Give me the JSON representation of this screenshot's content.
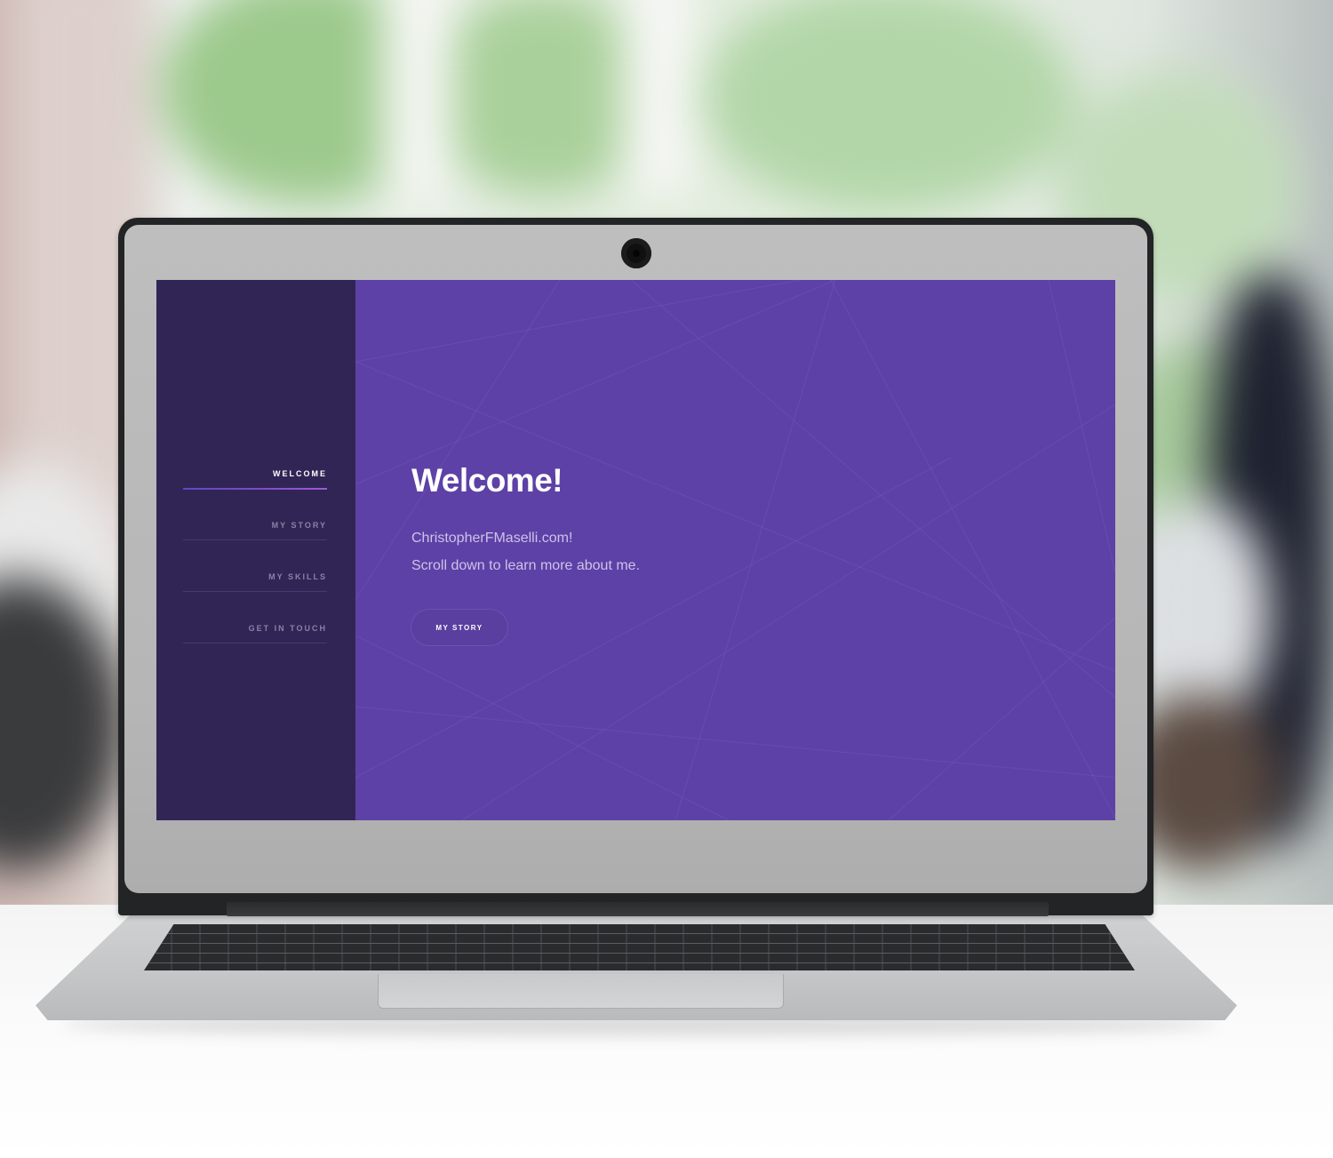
{
  "site": {
    "nav": [
      {
        "label": "WELCOME",
        "active": true
      },
      {
        "label": "MY STORY",
        "active": false
      },
      {
        "label": "MY SKILLS",
        "active": false
      },
      {
        "label": "GET IN TOUCH",
        "active": false
      }
    ],
    "hero": {
      "title": "Welcome!",
      "line1": "ChristopherFMaselli.com!",
      "line2": "Scroll down to learn more about me.",
      "button_label": "MY STORY"
    }
  },
  "colors": {
    "main_background": "#5d41a6",
    "sidebar_background": "#312556",
    "active_underline": "#7d4cc7",
    "subtitle_text": "#cdc3ea"
  },
  "icons": [
    "webcam-icon"
  ]
}
